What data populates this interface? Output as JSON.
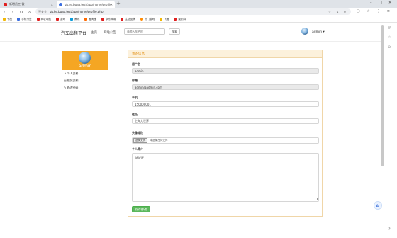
{
  "browser": {
    "tabs": [
      {
        "title": "新增员工-微",
        "active": false,
        "color": "#e02020"
      },
      {
        "title": "qiche.buaa.test/app/home/profile.php",
        "active": true,
        "color": "#3b6ee0"
      }
    ],
    "address": {
      "security": "不安全",
      "url": "qiche.buaa.test/app/home/profile.php"
    },
    "bookmarks": [
      {
        "label": "书签",
        "color": "#f2b705"
      },
      {
        "label": "手机书签",
        "color": "#3b6ee0"
      },
      {
        "label": "网址导航",
        "color": "#e02020"
      },
      {
        "label": "游戏",
        "color": "#e02020"
      },
      {
        "label": "腾讯",
        "color": "#0a9bd9"
      },
      {
        "label": "爱淘宝",
        "color": "#ff6a00"
      },
      {
        "label": "京东商城",
        "color": "#e02020"
      },
      {
        "label": "生活品牌",
        "color": "#e02020"
      },
      {
        "label": "热门游戏",
        "color": "#ff8a00"
      },
      {
        "label": "飞猪",
        "color": "#f2b705"
      },
      {
        "label": "聚划算",
        "color": "#e02020"
      }
    ]
  },
  "site": {
    "brand": "汽车出租平台",
    "nav": [
      "主页",
      "网站公告"
    ],
    "search": {
      "placeholder": "请输入车名称",
      "button": "搜索"
    },
    "user": {
      "name": "admin ▾"
    }
  },
  "profile_card": {
    "name": "admin",
    "menu": [
      {
        "icon": "♟",
        "label": "个人资料"
      },
      {
        "icon": "▤",
        "label": "租赁资料"
      },
      {
        "icon": "✎",
        "label": "修改密码"
      }
    ]
  },
  "form": {
    "panel_title": "我的信息",
    "username": {
      "label": "用户名",
      "value": "admin"
    },
    "email": {
      "label": "邮箱",
      "value": "admin@admin.com"
    },
    "phone": {
      "label": "手机",
      "value": "150000001"
    },
    "address": {
      "label": "住址",
      "value": "上海大世界"
    },
    "avatar": {
      "label": "头像修改",
      "button": "选择文件",
      "status": "未选择任何文件"
    },
    "bio": {
      "label": "个人简介",
      "value": "好好好"
    },
    "save_button": "保存修改"
  },
  "assistant": {
    "label": "AI"
  },
  "colors": {
    "accent": "#f5a623",
    "panel_header": "#fcf1dc",
    "save": "#5cb85c"
  }
}
